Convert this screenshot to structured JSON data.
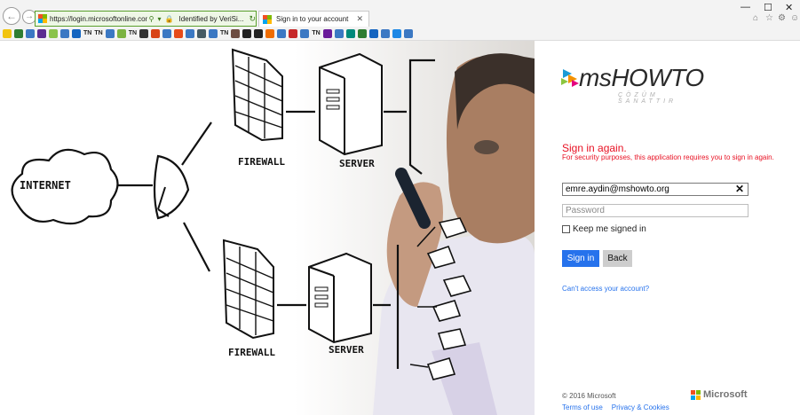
{
  "browser": {
    "url": "https://login.microsoftonline.com/login.srf?w",
    "identity": "Identified by VeriSi...",
    "tab_title": "Sign in to your account",
    "fav_labels": [
      "TN",
      "TN",
      "TN",
      "TN",
      "TN",
      "TN"
    ]
  },
  "hero": {
    "internet_label": "INTERNET",
    "firewall_label": "FIREWALL",
    "server_label": "SERVER"
  },
  "brand": {
    "logo_text": "msHOWTO",
    "logo_tagline": "ÇÖZÜM SANATTIR"
  },
  "signin": {
    "heading": "Sign in again.",
    "message": "For security purposes, this application requires you to sign in again.",
    "email_value": "emre.aydin@mshowto.org",
    "password_placeholder": "Password",
    "keep_label": "Keep me signed in",
    "signin_label": "Sign in",
    "back_label": "Back",
    "cant_access": "Can't access your account?"
  },
  "footer": {
    "copyright": "© 2016 Microsoft",
    "terms": "Terms of use",
    "privacy": "Privacy & Cookies",
    "ms_word": "Microsoft"
  },
  "colors": {
    "error": "#e81123",
    "primary": "#2672ec",
    "ms_red": "#f25022",
    "ms_green": "#7fba00",
    "ms_blue": "#00a4ef",
    "ms_yellow": "#ffb900"
  }
}
